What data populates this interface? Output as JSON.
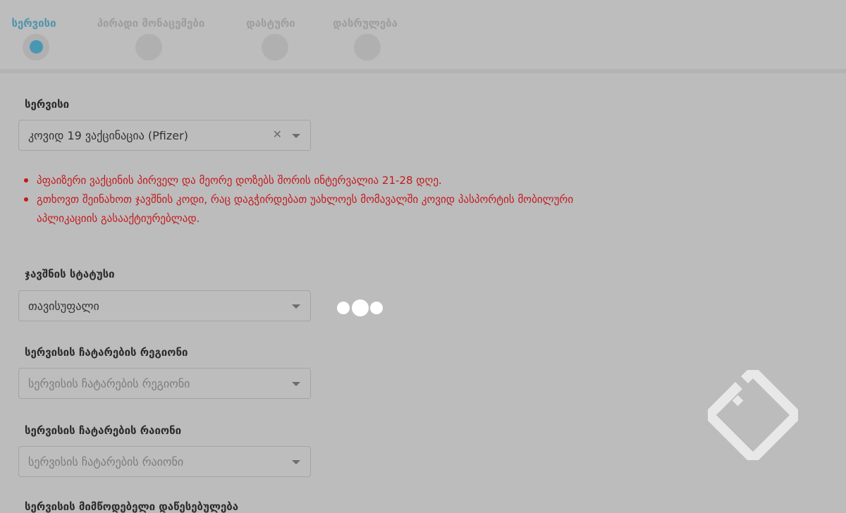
{
  "steps": [
    {
      "label": "სერვისი",
      "active": true
    },
    {
      "label": "პირადი მონაცემები",
      "active": false
    },
    {
      "label": "დასტური",
      "active": false
    },
    {
      "label": "დასრულება",
      "active": false
    }
  ],
  "service": {
    "label": "სერვისი",
    "value": "კოვიდ 19 ვაქცინაცია (Pfizer)"
  },
  "notes": [
    "პფაიზერი ვაქცინის პირველ და მეორე დოზებს შორის ინტერვალია 21-28 დღე.",
    "გთხოვთ შეინახოთ ჯავშნის კოდი, რაც დაგჭირდებათ უახლოეს მომავალში კოვიდ პასპორტის მობილური აპლიკაციის გასააქტიურებლად."
  ],
  "booking_status": {
    "label": "ჯავშნის სტატუსი",
    "value": "თავისუფალი"
  },
  "region": {
    "label": "სერვისის ჩატარების რეგიონი",
    "placeholder": "სერვისის ჩატარების რეგიონი"
  },
  "district": {
    "label": "სერვისის ჩატარების რაიონი",
    "placeholder": "სერვისის ჩატარების რაიონი"
  },
  "next_field": {
    "label": "სერვისის მიმწოდებელი დაწესებულება"
  },
  "colors": {
    "accent": "#4a97b4",
    "error": "#c3191e",
    "overlay": "#bcbcbc"
  },
  "icons": {
    "clear": "close-icon",
    "dropdown": "chevron-down-icon",
    "loader": "loading-dots-icon",
    "watermark": "diamond-logo"
  }
}
